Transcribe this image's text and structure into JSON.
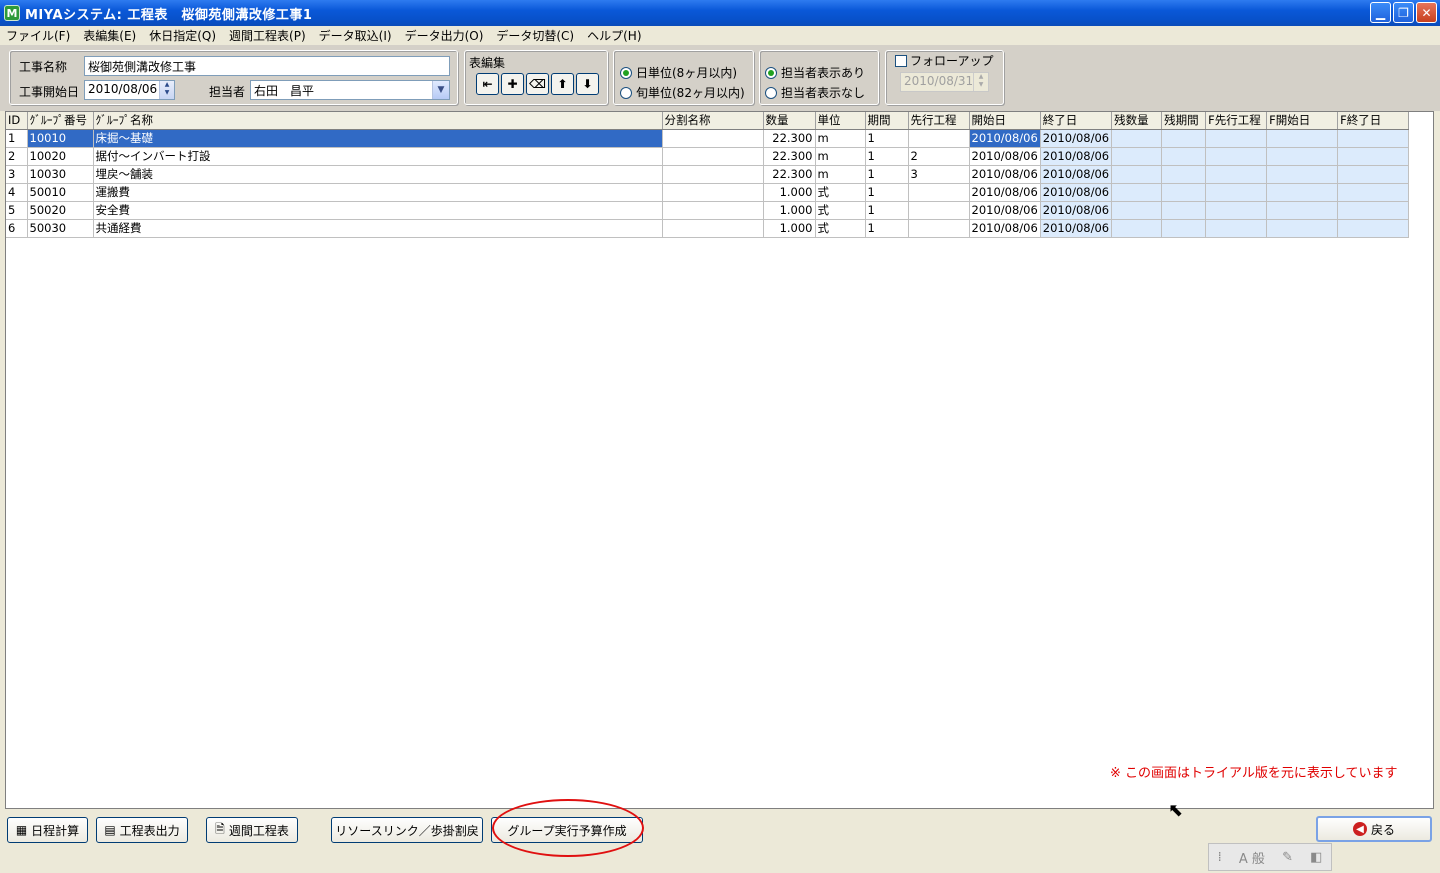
{
  "window": {
    "title": "MIYAシステム: 工程表　桜御苑側溝改修工事1",
    "icon_letter": "M",
    "buttons": [
      "minimize",
      "restore",
      "close"
    ]
  },
  "menu": [
    "ファイル(F)",
    "表編集(E)",
    "休日指定(Q)",
    "週間工程表(P)",
    "データ取込(I)",
    "データ出力(O)",
    "データ切替(C)",
    "ヘルプ(H)"
  ],
  "form": {
    "project_name_label": "工事名称",
    "project_name_value": "桜御苑側溝改修工事",
    "start_date_label": "工事開始日",
    "start_date_value": "2010/08/06",
    "manager_label": "担当者",
    "manager_value": "右田　昌平",
    "edit_group_label": "表編集",
    "unit_day": "日単位(8ヶ月以内)",
    "unit_decade": "旬単位(82ヶ月以内)",
    "show_manager_on": "担当者表示あり",
    "show_manager_off": "担当者表示なし",
    "follow_up_label": "フォローアップ",
    "follow_up_date": "2010/08/31"
  },
  "grid": {
    "columns": [
      "ID",
      "ｸﾞﾙｰﾌﾟ番号",
      "ｸﾞﾙｰﾌﾟ名称",
      "分割名称",
      "数量",
      "単位",
      "期間",
      "先行工程",
      "開始日",
      "終了日",
      "残数量",
      "残期間",
      "F先行工程",
      "F開始日",
      "F終了日"
    ],
    "rows": [
      {
        "id": "1",
        "group_no": "10010",
        "group_name": "床掘～基礎",
        "split": "",
        "qty": "22.300",
        "unit": "m",
        "period": "1",
        "pred": "",
        "start": "2010/08/06",
        "end": "2010/08/06"
      },
      {
        "id": "2",
        "group_no": "10020",
        "group_name": "据付～インバート打設",
        "split": "",
        "qty": "22.300",
        "unit": "m",
        "period": "1",
        "pred": "2",
        "start": "2010/08/06",
        "end": "2010/08/06"
      },
      {
        "id": "3",
        "group_no": "10030",
        "group_name": "埋戻～舗装",
        "split": "",
        "qty": "22.300",
        "unit": "m",
        "period": "1",
        "pred": "3",
        "start": "2010/08/06",
        "end": "2010/08/06"
      },
      {
        "id": "4",
        "group_no": "50010",
        "group_name": "運搬費",
        "split": "",
        "qty": "1.000",
        "unit": "式",
        "period": "1",
        "pred": "",
        "start": "2010/08/06",
        "end": "2010/08/06"
      },
      {
        "id": "5",
        "group_no": "50020",
        "group_name": "安全費",
        "split": "",
        "qty": "1.000",
        "unit": "式",
        "period": "1",
        "pred": "",
        "start": "2010/08/06",
        "end": "2010/08/06"
      },
      {
        "id": "6",
        "group_no": "50030",
        "group_name": "共通経費",
        "split": "",
        "qty": "1.000",
        "unit": "式",
        "period": "1",
        "pred": "",
        "start": "2010/08/06",
        "end": "2010/08/06"
      }
    ]
  },
  "trial_note": "※ この画面はトライアル版を元に表示しています",
  "buttons": {
    "schedule_calc": "日程計算",
    "output_chart": "工程表出力",
    "weekly_chart": "週間工程表",
    "resource_link": "リソースリンク／歩掛割戻",
    "group_budget": "グループ実行予算作成",
    "return": "戻る"
  },
  "ime": {
    "mode": "A 般"
  },
  "colors": {
    "selection": "#316AC5",
    "follow_cols": "#DCEBFC",
    "annotation": "#E01010",
    "titlebar": "#0A58D8"
  }
}
